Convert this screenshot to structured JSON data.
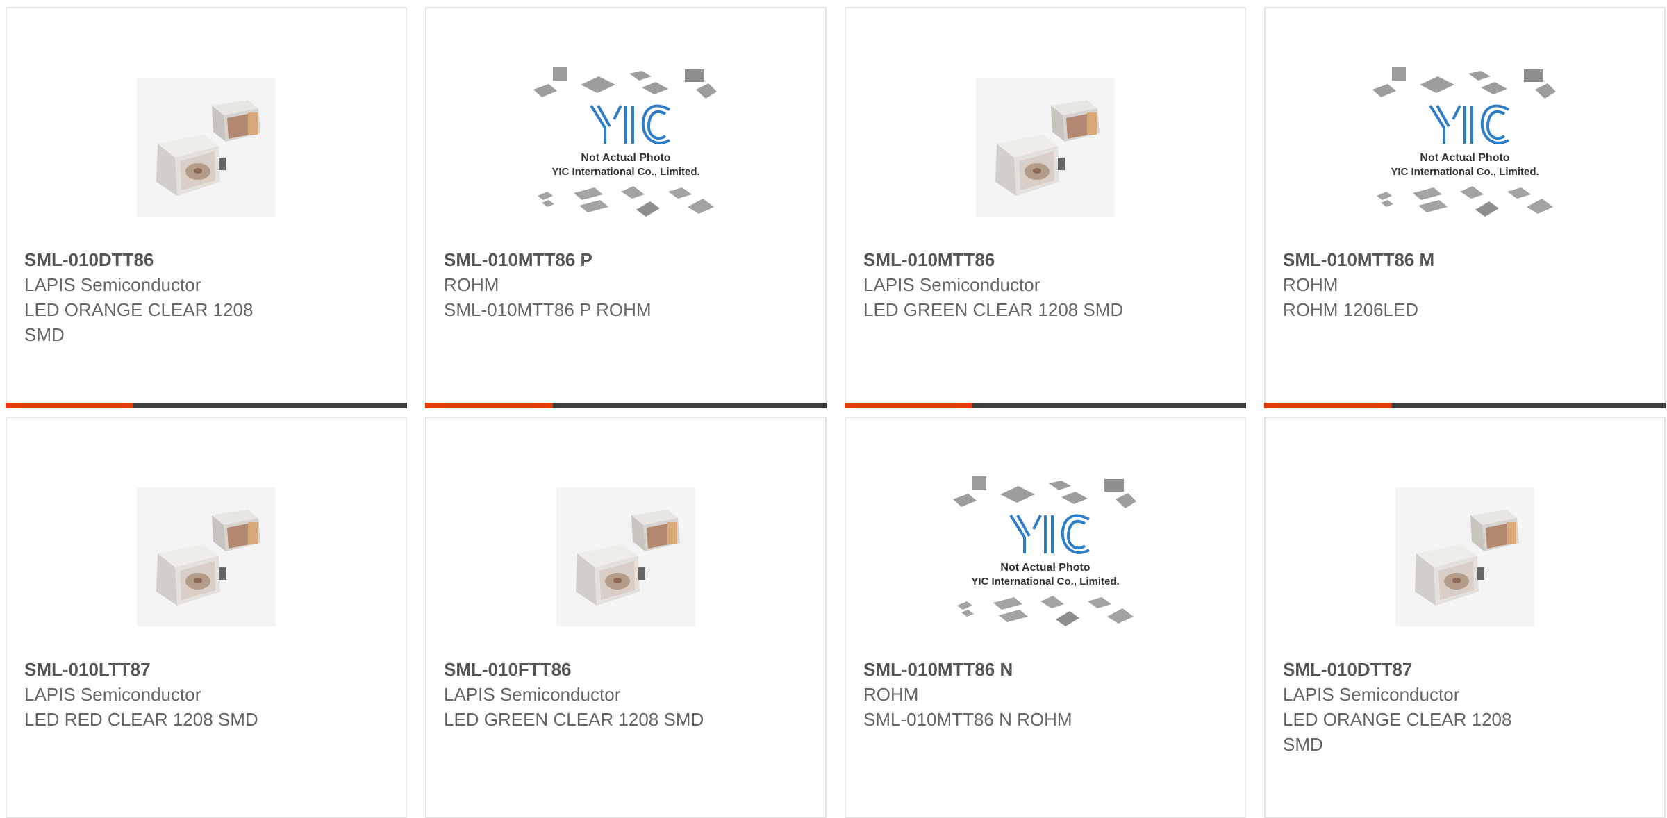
{
  "colors": {
    "accent": "#e43a0e",
    "bar": "#3d3d3d",
    "border": "#e4e4e4",
    "text": "#555555"
  },
  "placeholder": {
    "line1": "Not Actual Photo",
    "line2": "YIC International Co., Limited.",
    "logo": "YIC"
  },
  "products": [
    {
      "pn": "SML-010DTT86",
      "mfr": "LAPIS Semiconductor",
      "desc": "LED ORANGE CLEAR 1208 SMD",
      "image": "led-photo"
    },
    {
      "pn": "SML-010MTT86 P",
      "mfr": "ROHM",
      "desc": "SML-010MTT86 P ROHM",
      "image": "placeholder"
    },
    {
      "pn": "SML-010MTT86",
      "mfr": "LAPIS Semiconductor",
      "desc": "LED GREEN CLEAR 1208 SMD",
      "image": "led-photo"
    },
    {
      "pn": "SML-010MTT86 M",
      "mfr": "ROHM",
      "desc": "ROHM 1206LED",
      "image": "placeholder"
    },
    {
      "pn": "SML-010LTT87",
      "mfr": "LAPIS Semiconductor",
      "desc": "LED RED CLEAR 1208 SMD",
      "image": "led-photo"
    },
    {
      "pn": "SML-010FTT86",
      "mfr": "LAPIS Semiconductor",
      "desc": "LED GREEN CLEAR 1208 SMD",
      "image": "led-photo"
    },
    {
      "pn": "SML-010MTT86 N",
      "mfr": "ROHM",
      "desc": "SML-010MTT86 N ROHM",
      "image": "placeholder"
    },
    {
      "pn": "SML-010DTT87",
      "mfr": "LAPIS Semiconductor",
      "desc": "LED ORANGE CLEAR 1208 SMD",
      "image": "led-photo"
    }
  ]
}
